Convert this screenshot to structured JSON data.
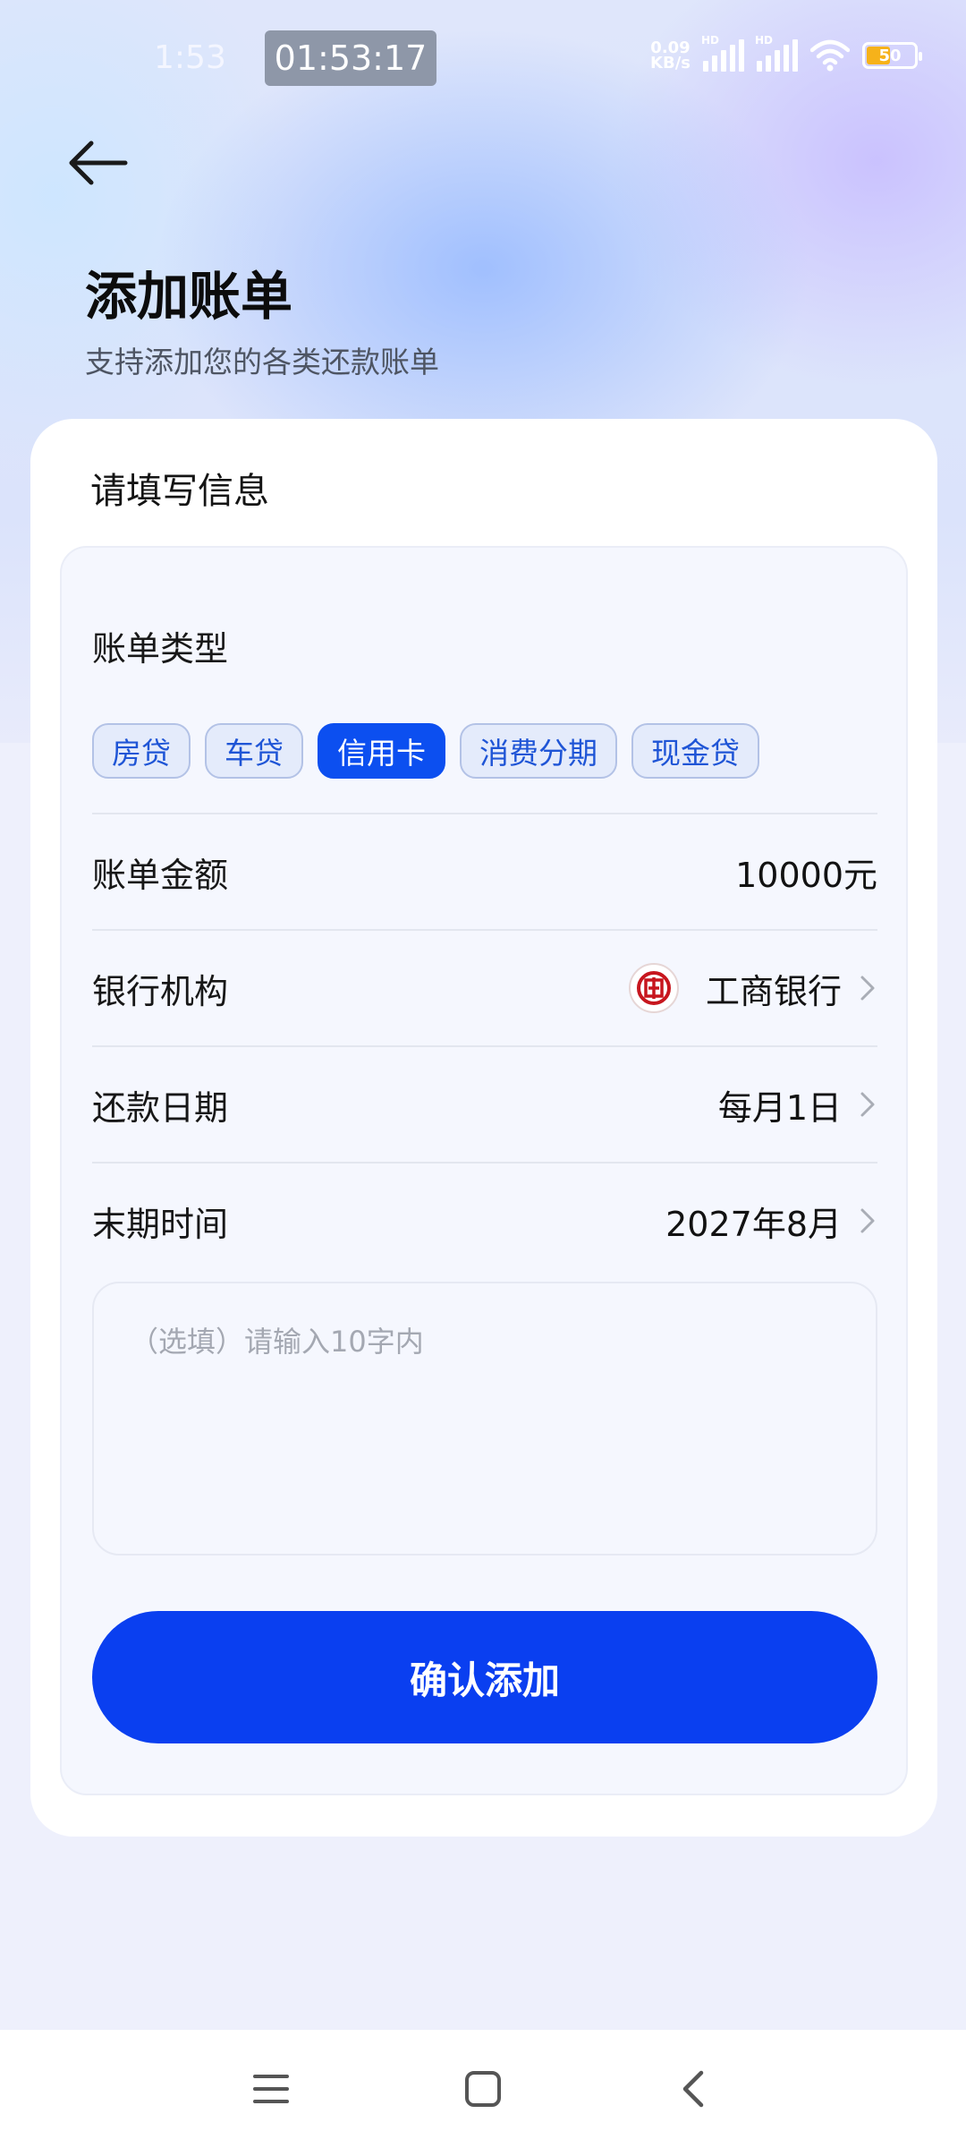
{
  "status_bar": {
    "time": "1:53",
    "clock": "01:53:17",
    "net_speed_value": "0.09",
    "net_speed_unit": "KB/s",
    "signal1_label": "HD",
    "signal2_label": "HD",
    "battery": "50"
  },
  "header": {
    "back_icon": "arrow-left-icon",
    "title": "添加账单",
    "subtitle": "支持添加您的各类还款账单"
  },
  "form": {
    "card_title": "请填写信息",
    "bill_type_label": "账单类型",
    "bill_types": [
      "房贷",
      "车贷",
      "信用卡",
      "消费分期",
      "现金贷"
    ],
    "selected_bill_type": "信用卡",
    "amount": {
      "label": "账单金额",
      "value": "10000元"
    },
    "bank": {
      "label": "银行机构",
      "value": "工商银行",
      "logo_icon": "icbc-logo-icon"
    },
    "repay_date": {
      "label": "还款日期",
      "value": "每月1日"
    },
    "end_time": {
      "label": "末期时间",
      "value": "2027年8月"
    },
    "note_placeholder": "（选填）请输入10字内",
    "confirm_label": "确认添加"
  },
  "colors": {
    "primary": "#0a3ff0",
    "chip_bg": "#e4ebfb",
    "chip_text": "#1f55d6",
    "bank_logo": "#c7161e"
  },
  "nav_bar": {
    "menu_icon": "menu-icon",
    "home_icon": "home-square-icon",
    "back_icon": "back-chevron-icon"
  }
}
